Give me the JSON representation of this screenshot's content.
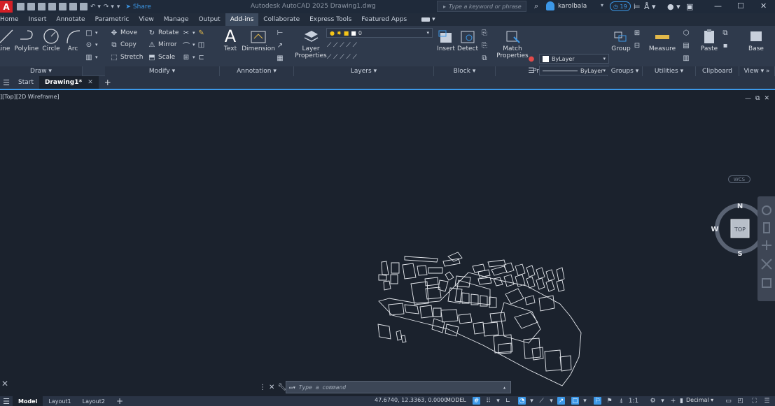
{
  "title_bar": {
    "app_logo": "A",
    "share_label": "Share",
    "title": "Autodesk AutoCAD 2025   Drawing1.dwg",
    "search_placeholder": "Type a keyword or phrase",
    "user_name": "karolbala",
    "badge_count": "19"
  },
  "ribbon_tabs": [
    {
      "label": "Home"
    },
    {
      "label": "Insert"
    },
    {
      "label": "Annotate"
    },
    {
      "label": "Parametric"
    },
    {
      "label": "View"
    },
    {
      "label": "Manage"
    },
    {
      "label": "Output"
    },
    {
      "label": "Add-ins",
      "active": true
    },
    {
      "label": "Collaborate"
    },
    {
      "label": "Express Tools"
    },
    {
      "label": "Featured Apps"
    }
  ],
  "ribbon": {
    "draw": {
      "title": "Draw",
      "line": "Line",
      "polyline": "Polyline",
      "circle": "Circle",
      "arc": "Arc"
    },
    "modify": {
      "title": "Modify",
      "move": "Move",
      "rotate": "Rotate",
      "copy": "Copy",
      "mirror": "Mirror",
      "stretch": "Stretch",
      "scale": "Scale"
    },
    "annotation": {
      "title": "Annotation",
      "text": "Text",
      "dimension": "Dimension"
    },
    "layers": {
      "title": "Layers",
      "layer_properties_1": "Layer",
      "layer_properties_2": "Properties",
      "current_layer": "0"
    },
    "block": {
      "title": "Block",
      "insert": "Insert",
      "detect": "Detect"
    },
    "properties": {
      "title": "Properties",
      "match_1": "Match",
      "match_2": "Properties",
      "color": "ByLayer",
      "linetype": "ByLayer",
      "lineweight": "ByLayer"
    },
    "groups": {
      "title": "Groups",
      "group": "Group"
    },
    "utilities": {
      "title": "Utilities",
      "measure": "Measure"
    },
    "clipboard": {
      "title": "Clipboard",
      "paste": "Paste"
    },
    "view": {
      "title": "View",
      "base": "Base"
    }
  },
  "doc_tabs": {
    "start": "Start",
    "drawing": "Drawing1*"
  },
  "viewport": {
    "label": "][Top][2D Wireframe]",
    "viewcube": {
      "n": "N",
      "s": "S",
      "e": "E",
      "w": "W",
      "face": "TOP"
    },
    "wcs": "WCS"
  },
  "command": {
    "placeholder": "Type a command"
  },
  "status": {
    "tabs": [
      {
        "label": "Model",
        "active": true
      },
      {
        "label": "Layout1"
      },
      {
        "label": "Layout2"
      }
    ],
    "coords": "47.6740, 12.3363, 0.0000",
    "model": "MODEL",
    "scale": "1:1",
    "units": "Decimal"
  }
}
